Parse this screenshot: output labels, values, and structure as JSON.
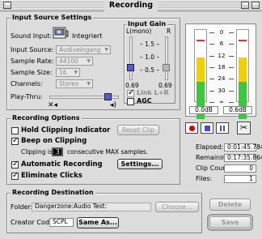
{
  "window": {
    "title": "Recording"
  },
  "input_source": {
    "title": "Input Source Settings",
    "sound_input_label": "Sound Input:",
    "sound_input_value": "Integriert",
    "input_source_label": "Input Source:",
    "input_source_value": "Audioeingang",
    "sample_rate_label": "Sample Rate:",
    "sample_rate_value": "44100",
    "sample_size_label": "Sample Size:",
    "sample_size_value": "16",
    "channels_label": "Channels:",
    "channels_value": "Stereo",
    "play_thru_label": "Play-Thru:",
    "play_thru_level": 0.88
  },
  "input_gain": {
    "title": "Input Gain",
    "left_label": "L(mono)",
    "right_label": "R",
    "ticks": [
      "1.5",
      "1.0",
      "0.5"
    ],
    "left_value": "0.69",
    "right_value": "0.69",
    "link_label": "Link L+R",
    "agc_label": "AGC"
  },
  "meters": {
    "scale": [
      "0",
      "6",
      "12",
      "18",
      "24",
      "30",
      "∞"
    ],
    "left_db": "0.0dB",
    "right_db": "0.6dB"
  },
  "transport": {
    "record": "record",
    "stop": "stop",
    "pause": "pause"
  },
  "status": {
    "elapsed_label": "Elapsed:",
    "elapsed_value": "0:01:45.784",
    "remaining_label": "Remaining:",
    "remaining_value": "0:17:35.864",
    "clip_count_label": "Clip Count:",
    "clip_count_value": "0",
    "files_label": "Files:",
    "files_value": "1"
  },
  "recording_options": {
    "title": "Recording Options",
    "hold_clip_label": "Hold Clipping Indicator",
    "reset_clip_label": "Reset Clip",
    "beep_label": "Beep on Clipping",
    "clipping_is_label": "Clipping is",
    "clipping_value": "3",
    "consecutive_label": "consecutive MAX samples.",
    "auto_label": "Automatic Recording",
    "settings_label": "Settings...",
    "eliminate_label": "Eliminate Clicks"
  },
  "destination": {
    "title": "Recording Destination",
    "folder_label": "Folder:",
    "folder_value": "Dangerzone:Audio Test:",
    "choose_label": "Choose...",
    "creator_label": "Creator Code:",
    "creator_value": "SCPL",
    "same_as_label": "Same As..."
  },
  "actions": {
    "delete_label": "Delete",
    "save_label": "Save"
  },
  "colors": {
    "meter_green": "#3cc83c",
    "meter_yellow": "#f0d000",
    "meter_red": "#e03030",
    "record_red": "#d00000"
  }
}
